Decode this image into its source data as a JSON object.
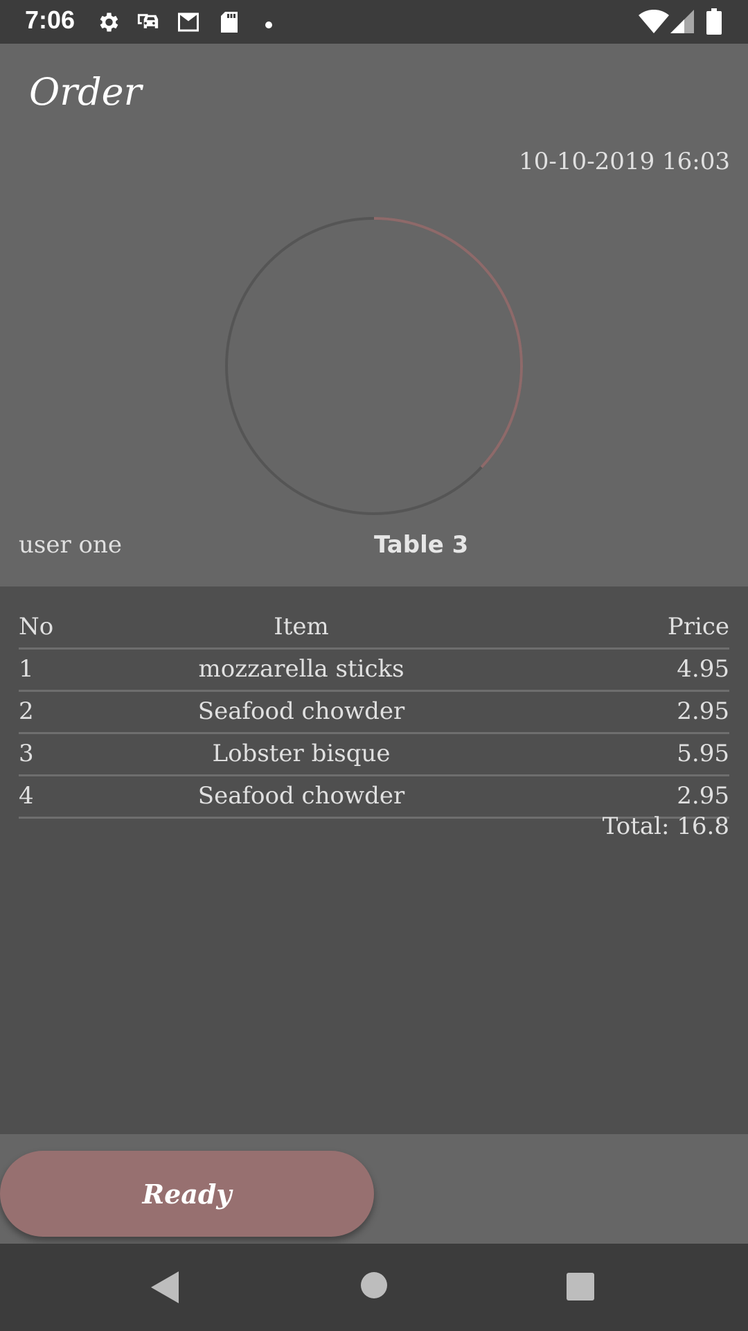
{
  "status_bar": {
    "time": "7:06",
    "icons": [
      "gear-icon",
      "car-icon",
      "gmail-icon",
      "sd-card-icon",
      "dot-icon",
      "wifi-icon",
      "signal-icon",
      "battery-icon"
    ]
  },
  "header": {
    "title": "Order",
    "datetime": "10-10-2019 16:03"
  },
  "timer": {
    "progress": 0.37,
    "progress_color": "#8e6a6a",
    "track_color": "#555555"
  },
  "order_info": {
    "user": "user one",
    "table": "Table 3"
  },
  "order_table": {
    "columns": [
      "No",
      "Item",
      "Price"
    ],
    "rows": [
      {
        "no": "1",
        "item": "mozzarella sticks",
        "price": "4.95"
      },
      {
        "no": "2",
        "item": "Seafood chowder",
        "price": "2.95"
      },
      {
        "no": "3",
        "item": "Lobster bisque",
        "price": "5.95"
      },
      {
        "no": "4",
        "item": "Seafood chowder",
        "price": "2.95"
      }
    ],
    "total": "Total: 16.8"
  },
  "actions": {
    "ready_label": "Ready",
    "accent": "#977070"
  },
  "nav_bar": {
    "icons": [
      "back-icon",
      "home-icon",
      "recents-icon"
    ]
  }
}
